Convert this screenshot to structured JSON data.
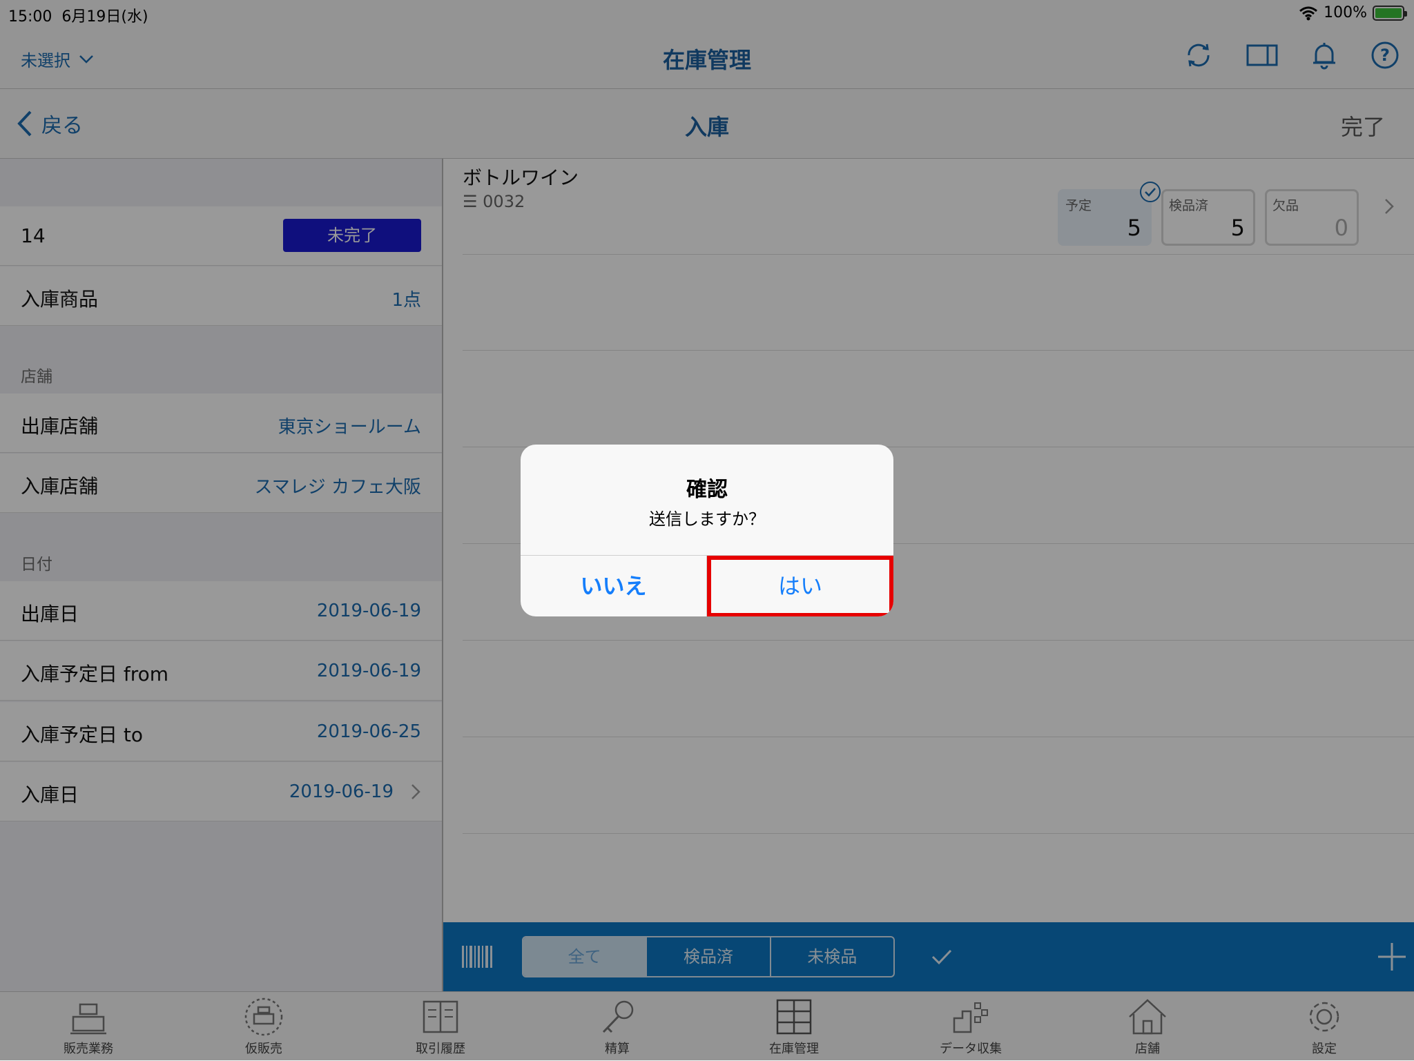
{
  "status_bar": {
    "time": "15:00",
    "date": "6月19日(水)",
    "battery": "100%"
  },
  "app_header": {
    "store_select": "未選択",
    "title": "在庫管理"
  },
  "nav": {
    "back_label": "戻る",
    "title": "入庫",
    "done_label": "完了"
  },
  "left_panel": {
    "id_value": "14",
    "status_badge": "未完了",
    "items_label": "入庫商品",
    "items_value": "1点",
    "store_section": "店舗",
    "out_store_label": "出庫店舗",
    "out_store_value": "東京ショールーム",
    "in_store_label": "入庫店舗",
    "in_store_value": "スマレジ カフェ大阪",
    "date_section": "日付",
    "out_date_label": "出庫日",
    "out_date_value": "2019-06-19",
    "plan_from_label": "入庫予定日 from",
    "plan_from_value": "2019-06-19",
    "plan_to_label": "入庫予定日 to",
    "plan_to_value": "2019-06-25",
    "in_date_label": "入庫日",
    "in_date_value": "2019-06-19"
  },
  "product": {
    "name": "ボトルワイン",
    "code": "0032",
    "planned_label": "予定",
    "planned_value": "5",
    "inspected_label": "検品済",
    "inspected_value": "5",
    "missing_label": "欠品",
    "missing_value": "0"
  },
  "toolbar": {
    "filters": [
      "全て",
      "検品済",
      "未検品"
    ]
  },
  "tabs": [
    "販売業務",
    "仮販売",
    "取引履歴",
    "精算",
    "在庫管理",
    "データ収集",
    "店舗",
    "設定"
  ],
  "dialog": {
    "title": "確認",
    "message": "送信しますか？",
    "no_label": "いいえ",
    "yes_label": "はい"
  },
  "colors": {
    "accent": "#1b6bb0",
    "toolbar": "#0c77c4",
    "badge": "#1a1ad0",
    "highlight": "#e60000"
  }
}
